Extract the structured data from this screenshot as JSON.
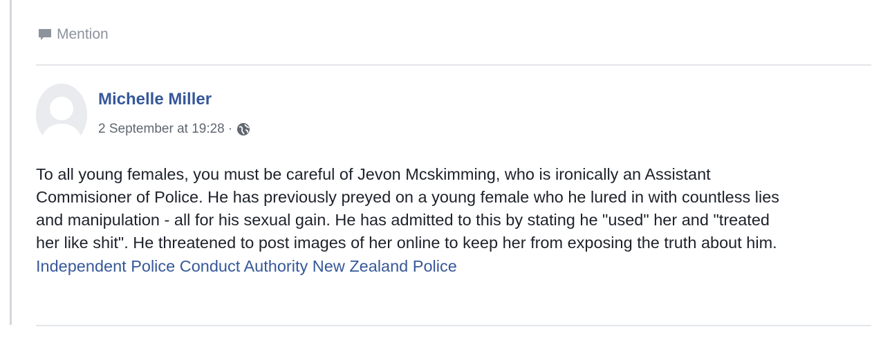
{
  "mention": {
    "label": "Mention",
    "icon": "speech-bubble-icon"
  },
  "post": {
    "author": "Michelle Miller",
    "timestamp": "2 September at 19:28",
    "separator": "·",
    "privacy_icon": "globe-icon",
    "body_lines": [
      "To all young females, you must be careful of Jevon Mcskimming, who is ironically an Assistant",
      "Commisioner of Police. He has previously preyed on a young female who he lured in with countless lies",
      "and manipulation - all for his sexual gain. He has admitted to this by stating he \"used\" her and \"treated",
      "her like shit\". He threatened to post images of her online to keep her from exposing the truth about him."
    ],
    "tags": [
      "Independent Police Conduct Authority",
      "New Zealand Police"
    ]
  },
  "colors": {
    "link": "#365899",
    "muted": "#8c939d",
    "text": "#1d2129",
    "divider": "#e3e5e9"
  }
}
